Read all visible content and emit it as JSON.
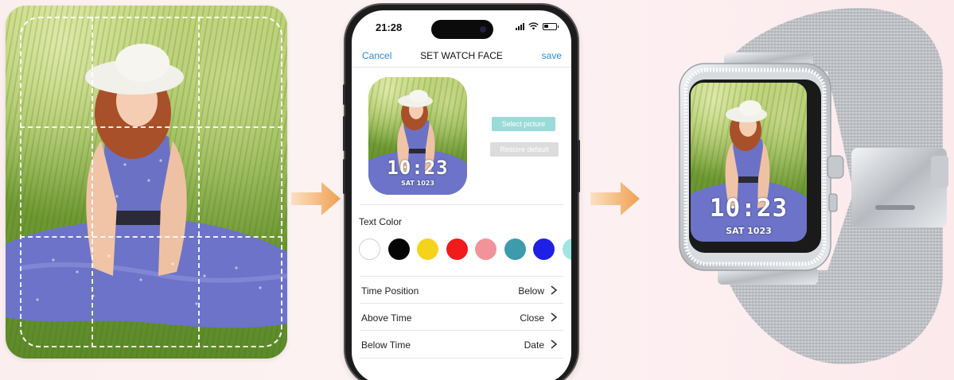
{
  "phone": {
    "status": {
      "time": "21:28"
    },
    "nav": {
      "cancel": "Cancel",
      "title": "SET WATCH FACE",
      "save": "save"
    },
    "preview": {
      "time": "10:23",
      "date": "SAT 1023"
    },
    "buttons": {
      "select_picture": "Select picture",
      "restore_default": "Restore default"
    },
    "text_color": {
      "label": "Text Color",
      "swatches": [
        "#ffffff",
        "#050505",
        "#f6d31b",
        "#f21b1b",
        "#f2939a",
        "#3d9bab",
        "#1f1fe6",
        "#9fe6e4"
      ]
    },
    "settings": [
      {
        "label": "Time Position",
        "value": "Below"
      },
      {
        "label": "Above Time",
        "value": "Close"
      },
      {
        "label": "Below Time",
        "value": "Date"
      }
    ]
  },
  "watch": {
    "time": "10:23",
    "date": "SAT 1023"
  },
  "colors": {
    "accent_link": "#2a8bd8",
    "select_button": "#9adbd8",
    "arrow": "#f0a050"
  }
}
